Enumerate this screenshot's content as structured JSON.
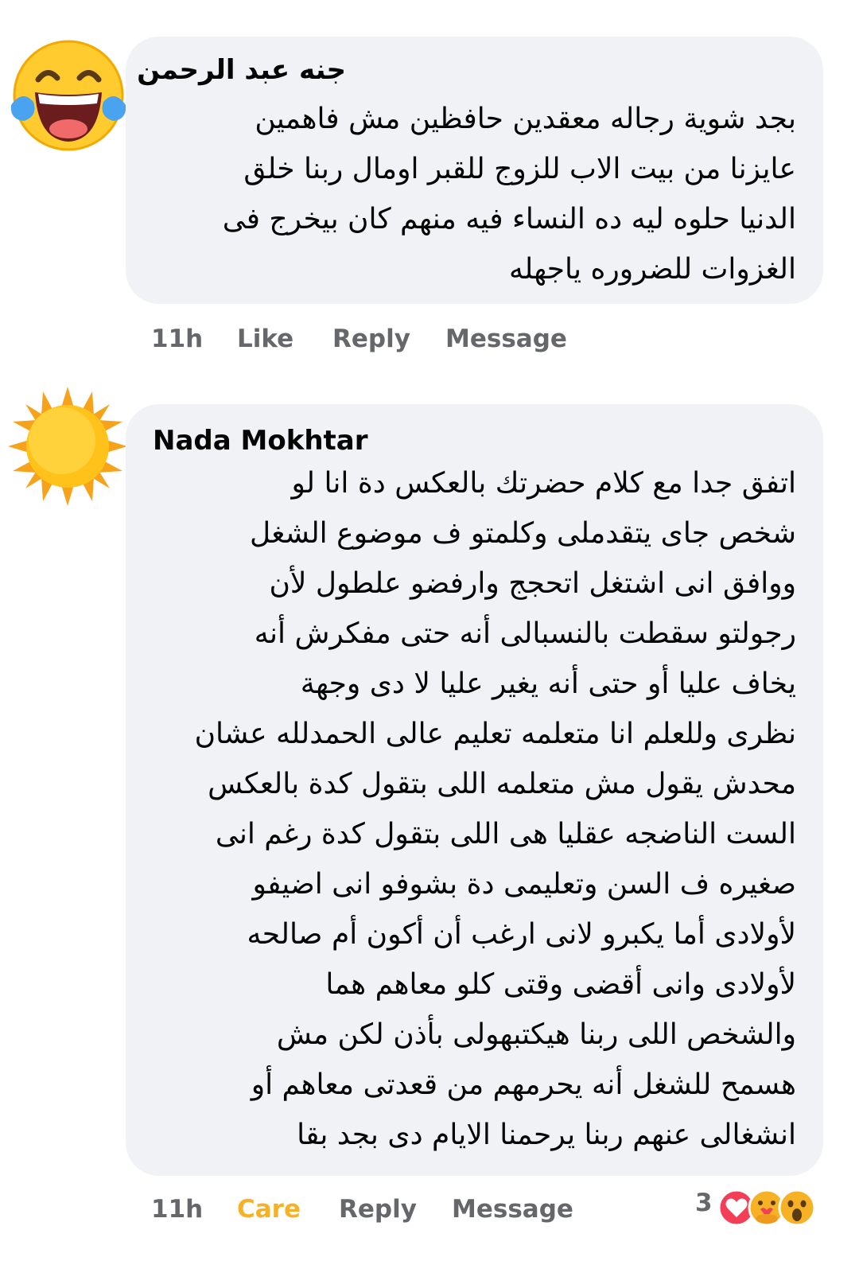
{
  "comments": [
    {
      "author": "جنه عبد الرحمن",
      "avatar_icon": "laughing-tears-emoji",
      "lines": [
        "بجد شوية رجاله معقدين حافظين مش فاهمين",
        "عايزنا من بيت الاب للزوج للقبر اومال ربنا خلق",
        "الدنيا حلوه ليه ده النساء فيه منهم كان بيخرج فى",
        "الغزوات للضروره ياجهله"
      ],
      "time": "11h",
      "reaction_label": "Like",
      "reply_label": "Reply",
      "message_label": "Message"
    },
    {
      "author": "Nada Mokhtar",
      "avatar_icon": "sun-emoji",
      "lines": [
        "اتفق جدا مع كلام حضرتك بالعكس دة انا لو",
        "شخص جاى يتقدملى وكلمتو ف موضوع الشغل",
        "ووافق انى اشتغل اتحجج وارفضو علطول لأن",
        "رجولتو سقطت بالنسبالى أنه حتى مفكرش أنه",
        "يخاف عليا أو حتى أنه يغير عليا لا دى وجهة",
        "نظرى وللعلم انا متعلمه تعليم عالى الحمدلله عشان",
        "محدش يقول مش متعلمه اللى بتقول كدة بالعكس",
        "الست الناضجه عقليا هى اللى بتقول كدة رغم انى",
        "صغيره ف السن وتعليمى دة بشوفو انى اضيفو",
        "لأولادى أما يكبرو لانى ارغب أن أكون أم صالحه",
        "لأولادى وانى أقضى وقتى كلو معاهم هما",
        "والشخص اللى ربنا هيكتبهولى بأذن لكن مش",
        "هسمح للشغل أنه يحرمهم من قعدتى معاهم أو",
        "انشغالى عنهم ربنا يرحمنا الايام دى بجد بقا"
      ],
      "time": "11h",
      "reaction_label": "Care",
      "reply_label": "Reply",
      "message_label": "Message",
      "reaction_count": "3",
      "reaction_icons": [
        "love-icon",
        "care-icon",
        "wow-icon"
      ],
      "care_color": "#f7b125"
    }
  ]
}
